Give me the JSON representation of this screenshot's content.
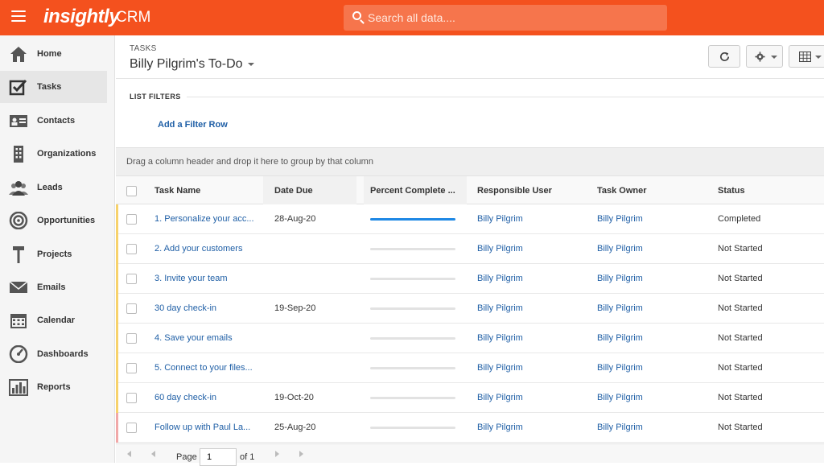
{
  "app": {
    "logo": "insightly",
    "product": "CRM"
  },
  "search": {
    "placeholder": "Search all data...."
  },
  "sidebar": {
    "items": [
      {
        "label": "Home",
        "icon": "home-icon"
      },
      {
        "label": "Tasks",
        "icon": "tasks-check-icon",
        "active": true
      },
      {
        "label": "Contacts",
        "icon": "contact-card-icon"
      },
      {
        "label": "Organizations",
        "icon": "building-icon"
      },
      {
        "label": "Leads",
        "icon": "people-icon"
      },
      {
        "label": "Opportunities",
        "icon": "target-icon"
      },
      {
        "label": "Projects",
        "icon": "hammer-icon"
      },
      {
        "label": "Emails",
        "icon": "envelope-icon"
      },
      {
        "label": "Calendar",
        "icon": "calendar-icon"
      },
      {
        "label": "Dashboards",
        "icon": "gauge-icon"
      },
      {
        "label": "Reports",
        "icon": "bar-chart-icon"
      }
    ]
  },
  "header": {
    "caption": "TASKS",
    "title": "Billy Pilgrim's To-Do"
  },
  "toolbar": {
    "refresh_icon": "refresh-icon",
    "settings_icon": "gear-icon",
    "view_icon": "grid-view-icon"
  },
  "filters": {
    "label": "LIST FILTERS",
    "add_row": "Add a Filter Row"
  },
  "group": {
    "hint": "Drag a column header and drop it here to group by that column"
  },
  "columns": [
    "Task Name",
    "Date Due",
    "Percent Complete ...",
    "Responsible User",
    "Task Owner",
    "Status"
  ],
  "rows": [
    {
      "task": "1. Personalize your acc...",
      "due": "28-Aug-20",
      "percent": 100,
      "responsible": "Billy Pilgrim",
      "owner": "Billy Pilgrim",
      "status": "Completed",
      "accent": "#f7d26b"
    },
    {
      "task": "2. Add your customers",
      "due": "",
      "percent": 0,
      "responsible": "Billy Pilgrim",
      "owner": "Billy Pilgrim",
      "status": "Not Started",
      "accent": "#f7d26b"
    },
    {
      "task": "3. Invite your team",
      "due": "",
      "percent": 0,
      "responsible": "Billy Pilgrim",
      "owner": "Billy Pilgrim",
      "status": "Not Started",
      "accent": "#f7d26b"
    },
    {
      "task": "30 day check-in",
      "due": "19-Sep-20",
      "percent": 0,
      "responsible": "Billy Pilgrim",
      "owner": "Billy Pilgrim",
      "status": "Not Started",
      "accent": "#f7d26b"
    },
    {
      "task": "4. Save your emails",
      "due": "",
      "percent": 0,
      "responsible": "Billy Pilgrim",
      "owner": "Billy Pilgrim",
      "status": "Not Started",
      "accent": "#f7d26b"
    },
    {
      "task": "5. Connect to your files...",
      "due": "",
      "percent": 0,
      "responsible": "Billy Pilgrim",
      "owner": "Billy Pilgrim",
      "status": "Not Started",
      "accent": "#f7d26b"
    },
    {
      "task": "60 day check-in",
      "due": "19-Oct-20",
      "percent": 0,
      "responsible": "Billy Pilgrim",
      "owner": "Billy Pilgrim",
      "status": "Not Started",
      "accent": "#f7d26b"
    },
    {
      "task": "Follow up with Paul La...",
      "due": "25-Aug-20",
      "percent": 0,
      "responsible": "Billy Pilgrim",
      "owner": "Billy Pilgrim",
      "status": "Not Started",
      "accent": "#f1a8a8"
    }
  ],
  "pager": {
    "page_label": "Page",
    "page_value": "1",
    "of_label": "of 1"
  },
  "colors": {
    "brand": "#f4511e",
    "link": "#1f5fa6",
    "progress": "#1e88e5"
  }
}
